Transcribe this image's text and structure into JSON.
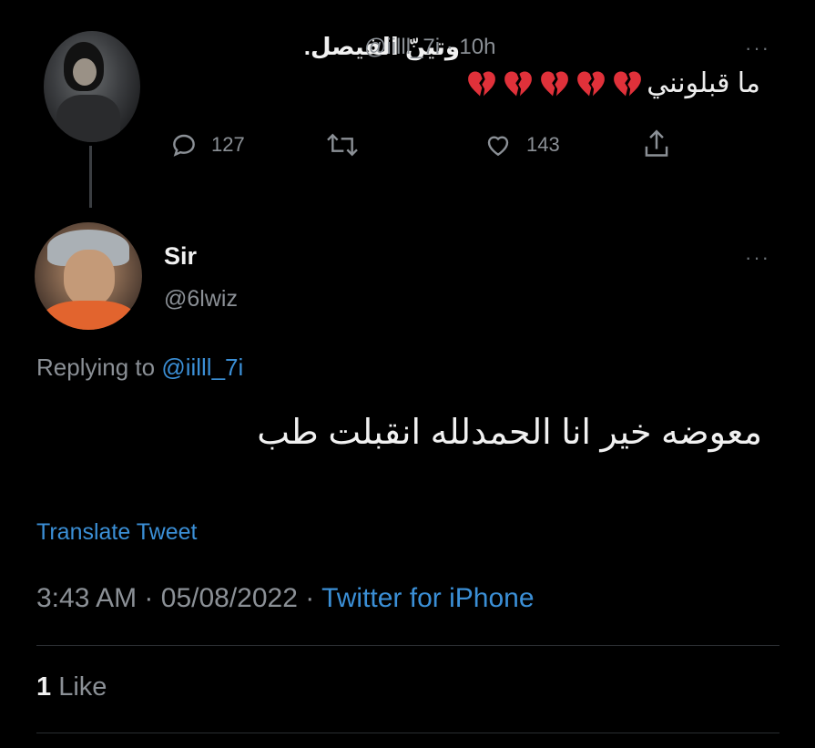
{
  "parent_tweet": {
    "display_name": "وتينّ الفيصل.",
    "handle": "@iilll_7i",
    "separator": "·",
    "time": "10h",
    "text": "ما قبلونني",
    "emoji_count": 5,
    "emoji_icon": "broken-heart",
    "reply_count": "127",
    "like_count": "143",
    "more_label": "···"
  },
  "reply_tweet": {
    "display_name": "Sir",
    "handle": "@6lwiz",
    "more_label": "···",
    "replying_prefix": "Replying to",
    "replying_handle": "@iilll_7i",
    "text": "معوضه خير انا الحمدلله انقبلت طب",
    "translate_label": "Translate Tweet",
    "time": "3:43 AM",
    "date": "05/08/2022",
    "separator": "·",
    "source": "Twitter for iPhone",
    "likes_count": "1",
    "likes_label": "Like"
  },
  "colors": {
    "background": "#000000",
    "text": "#e7e9ea",
    "muted": "#8b9096",
    "link": "#3b8fd6",
    "broken_heart": "#e0313a"
  }
}
